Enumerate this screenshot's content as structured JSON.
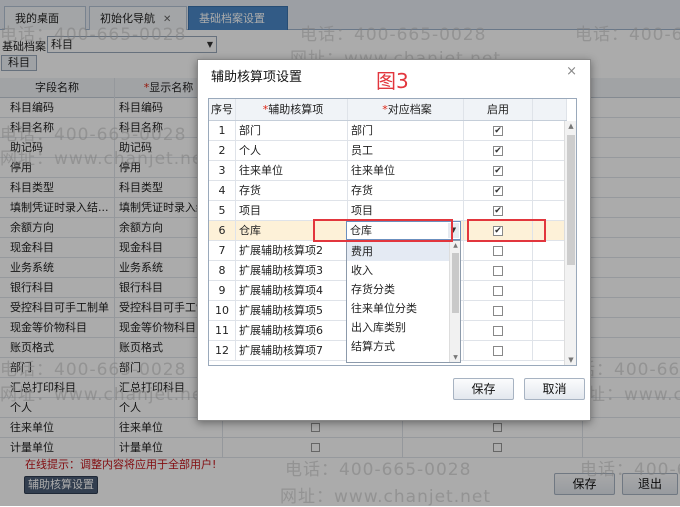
{
  "tabs": [
    {
      "label": "我的桌面",
      "closable": false,
      "active": false
    },
    {
      "label": "初始化导航",
      "closable": true,
      "active": false
    },
    {
      "label": "基础档案设置",
      "closable": true,
      "active": true
    }
  ],
  "archive_selector": {
    "label": "基础档案",
    "value": "科目"
  },
  "sub_tab": "科目",
  "field_table": {
    "headers": [
      "字段名称",
      "显示名称"
    ],
    "rows": [
      {
        "field": "科目编码",
        "display": "科目编码"
      },
      {
        "field": "科目名称",
        "display": "科目名称"
      },
      {
        "field": "助记码",
        "display": "助记码"
      },
      {
        "field": "停用",
        "display": "停用"
      },
      {
        "field": "科目类型",
        "display": "科目类型"
      },
      {
        "field": "填制凭证时录入结...",
        "display": "填制凭证时录入结..."
      },
      {
        "field": "余额方向",
        "display": "余额方向"
      },
      {
        "field": "现金科目",
        "display": "现金科目"
      },
      {
        "field": "业务系统",
        "display": "业务系统"
      },
      {
        "field": "银行科目",
        "display": "银行科目"
      },
      {
        "field": "受控科目可手工制单",
        "display": "受控科目可手工制单"
      },
      {
        "field": "现金等价物科目",
        "display": "现金等价物科目"
      },
      {
        "field": "账页格式",
        "display": "账页格式"
      },
      {
        "field": "部门",
        "display": "部门"
      },
      {
        "field": "汇总打印科目",
        "display": "汇总打印科目"
      },
      {
        "field": "个人",
        "display": "个人"
      },
      {
        "field": "往来单位",
        "display": "往来单位"
      },
      {
        "field": "计量单位",
        "display": "计量单位"
      }
    ]
  },
  "hint": "在线提示：调整内容将应用于全部用户!",
  "buttons": {
    "aux_settings": "辅助核算设置",
    "save": "保存",
    "exit": "退出"
  },
  "watermark": {
    "phone": "电话：400-665-0028",
    "site": "网址：www.chanjet.net"
  },
  "dialog": {
    "title": "辅助核算项设置",
    "figure_label": "图3",
    "close_icon": "×",
    "headers": {
      "seq": "序号",
      "aux_item": "辅助核算项",
      "archive": "对应档案",
      "enabled": "启用"
    },
    "rows": [
      {
        "seq": "1",
        "item": "部门",
        "archive": "部门",
        "enabled": true
      },
      {
        "seq": "2",
        "item": "个人",
        "archive": "员工",
        "enabled": true
      },
      {
        "seq": "3",
        "item": "往来单位",
        "archive": "往来单位",
        "enabled": true
      },
      {
        "seq": "4",
        "item": "存货",
        "archive": "存货",
        "enabled": true
      },
      {
        "seq": "5",
        "item": "项目",
        "archive": "项目",
        "enabled": true
      },
      {
        "seq": "6",
        "item": "仓库",
        "archive": "仓库",
        "enabled": true
      },
      {
        "seq": "7",
        "item": "扩展辅助核算项2",
        "archive": "",
        "enabled": false
      },
      {
        "seq": "8",
        "item": "扩展辅助核算项3",
        "archive": "",
        "enabled": false
      },
      {
        "seq": "9",
        "item": "扩展辅助核算项4",
        "archive": "",
        "enabled": false
      },
      {
        "seq": "10",
        "item": "扩展辅助核算项5",
        "archive": "",
        "enabled": false
      },
      {
        "seq": "11",
        "item": "扩展辅助核算项6",
        "archive": "",
        "enabled": false
      },
      {
        "seq": "12",
        "item": "扩展辅助核算项7",
        "archive": "",
        "enabled": false
      }
    ],
    "editing_value": "仓库",
    "dropdown_options": [
      "费用",
      "收入",
      "存货分类",
      "往来单位分类",
      "出入库类别",
      "结算方式"
    ],
    "buttons": {
      "save": "保存",
      "cancel": "取消"
    }
  },
  "colors": {
    "accent": "#4b88c8",
    "highlight_box": "#e2363d",
    "hint": "#c4161c"
  }
}
